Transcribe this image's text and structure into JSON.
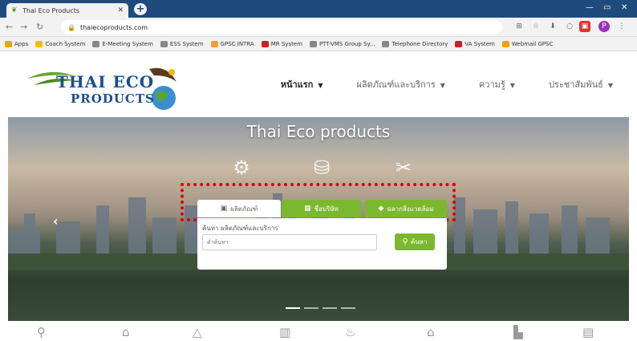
{
  "browser": {
    "tab_title": "Thai Eco Products",
    "url": "thaiecoproducts.com",
    "bookmarks": [
      {
        "label": "Apps",
        "color": "#e8a317"
      },
      {
        "label": "Coach System",
        "color": "#f0c000"
      },
      {
        "label": "E-Meeting System",
        "color": "#888888"
      },
      {
        "label": "ESS System",
        "color": "#888888"
      },
      {
        "label": "GPSC INTRA",
        "color": "#f0a030"
      },
      {
        "label": "MR System",
        "color": "#cc2222"
      },
      {
        "label": "PTT-VMS Group Sy...",
        "color": "#888888"
      },
      {
        "label": "Telephone Directory",
        "color": "#888888"
      },
      {
        "label": "VA System",
        "color": "#cc2222"
      },
      {
        "label": "Webmail GPSC",
        "color": "#f0a000"
      }
    ]
  },
  "logo": {
    "line1": "THAI ECO",
    "line2": "PRODUCTS"
  },
  "nav": [
    {
      "label": "หน้าแรก",
      "active": true
    },
    {
      "label": "ผลิตภัณฑ์และบริการ",
      "active": false
    },
    {
      "label": "ความรู้",
      "active": false
    },
    {
      "label": "ประชาสัมพันธ์",
      "active": false
    }
  ],
  "hero": {
    "title": "Thai Eco products",
    "icons": [
      "gear-globe-icon",
      "eco-jar-icon",
      "tools-icon"
    ]
  },
  "search": {
    "tabs": [
      "ผลิตภัณฑ์",
      "ชื่อบริษัท",
      "ฉลากสิ่งแวดล้อม"
    ],
    "label": "ค้นหา ผลิตภัณฑ์และบริการ",
    "placeholder": "คำค้นหา",
    "button": "ค้นหา"
  },
  "colors": {
    "accent": "#7cb82f",
    "brand": "#1d4f8c",
    "highlight": "#e00000"
  }
}
